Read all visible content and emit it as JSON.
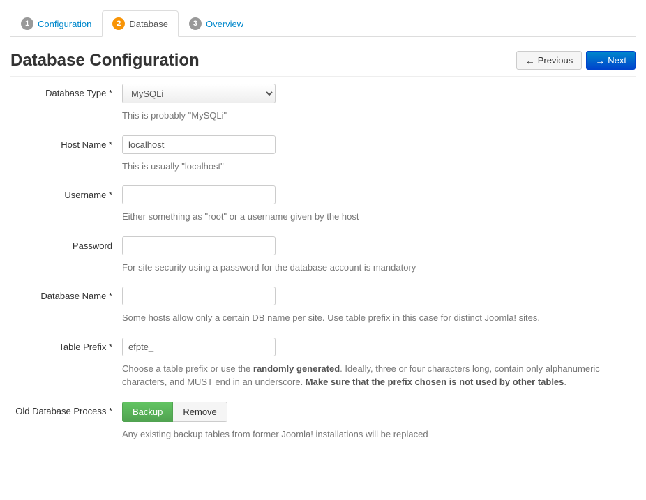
{
  "tabs": [
    {
      "num": "1",
      "label": "Configuration"
    },
    {
      "num": "2",
      "label": "Database"
    },
    {
      "num": "3",
      "label": "Overview"
    }
  ],
  "title": "Database Configuration",
  "nav": {
    "previous": "Previous",
    "next": "Next"
  },
  "fields": {
    "dbtype": {
      "label": "Database Type *",
      "value": "MySQLi",
      "help": "This is probably \"MySQLi\""
    },
    "hostname": {
      "label": "Host Name *",
      "value": "localhost",
      "help": "This is usually \"localhost\""
    },
    "username": {
      "label": "Username *",
      "value": "",
      "help": "Either something as \"root\" or a username given by the host"
    },
    "password": {
      "label": "Password",
      "value": "",
      "help": "For site security using a password for the database account is mandatory"
    },
    "dbname": {
      "label": "Database Name *",
      "value": "",
      "help": "Some hosts allow only a certain DB name per site. Use table prefix in this case for distinct Joomla! sites."
    },
    "prefix": {
      "label": "Table Prefix *",
      "value": "efpte_",
      "help_pre": "Choose a table prefix or use the ",
      "help_strong1": "randomly generated",
      "help_mid": ". Ideally, three or four characters long, contain only alphanumeric characters, and MUST end in an underscore. ",
      "help_strong2": "Make sure that the prefix chosen is not used by other tables",
      "help_post": "."
    },
    "olddb": {
      "label": "Old Database Process *",
      "backup": "Backup",
      "remove": "Remove",
      "help": "Any existing backup tables from former Joomla! installations will be replaced"
    }
  }
}
